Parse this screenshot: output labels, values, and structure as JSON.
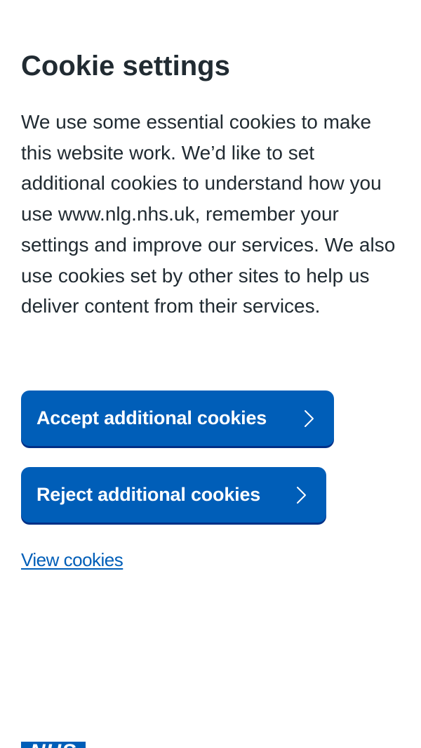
{
  "banner": {
    "title": "Cookie settings",
    "body": "We use some essential cookies to make this website work. We’d like to set additional cookies to understand how you use www.nlg.nhs.uk, remember your settings and improve our services. We also use cookies set by other sites to help us deliver content from their services.",
    "accept_label": "Accept additional cookies",
    "reject_label": "Reject additional cookies",
    "view_link": "View cookies"
  },
  "footer": {
    "logo_text": "NHS"
  },
  "colors": {
    "primary_blue": "#005eb8",
    "button_shadow": "#003087",
    "text": "#212b32",
    "background": "#ffffff"
  },
  "icons": {
    "button_chevron": "chevron-right-icon"
  }
}
